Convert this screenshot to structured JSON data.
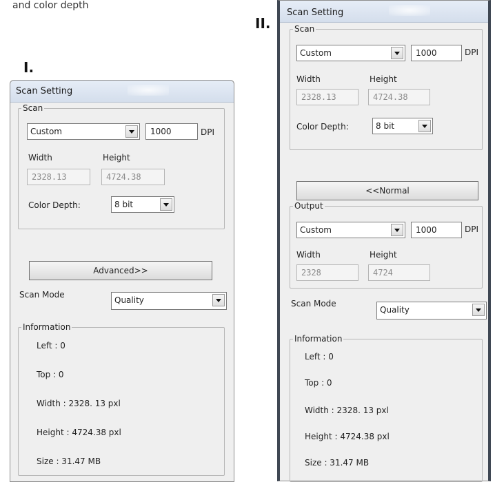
{
  "caption": "and color depth",
  "label_I": "I.",
  "label_II": "II.",
  "dialog1": {
    "title": "Scan Setting",
    "scan_legend": "Scan",
    "preset_value": "Custom",
    "dpi_value": "1000",
    "dpi_unit": "DPI",
    "width_label": "Width",
    "height_label": "Height",
    "width_value": "2328.13",
    "height_value": "4724.38",
    "color_depth_label": "Color Depth:",
    "color_depth_value": "8 bit",
    "advanced_button": "Advanced>>",
    "scan_mode_label": "Scan Mode",
    "scan_mode_value": "Quality",
    "info_legend": "Information",
    "info_left": "Left : 0",
    "info_top": "Top : 0",
    "info_width": "Width : 2328. 13 pxl",
    "info_height": "Height : 4724.38 pxl",
    "info_size": "Size : 31.47 MB"
  },
  "dialog2": {
    "title": "Scan Setting",
    "scan_legend": "Scan",
    "preset_value": "Custom",
    "dpi_value": "1000",
    "dpi_unit": "DPI",
    "width_label": "Width",
    "height_label": "Height",
    "width_value": "2328.13",
    "height_value": "4724.38",
    "color_depth_label": "Color Depth:",
    "color_depth_value": "8 bit",
    "normal_button": "<<Normal",
    "output_legend": "Output",
    "out_preset_value": "Custom",
    "out_dpi_value": "1000",
    "out_dpi_unit": "DPI",
    "out_width_label": "Width",
    "out_height_label": "Height",
    "out_width_value": "2328",
    "out_height_value": "4724",
    "scan_mode_label": "Scan Mode",
    "scan_mode_value": "Quality",
    "info_legend": "Information",
    "info_left": "Left : 0",
    "info_top": "Top : 0",
    "info_width": "Width : 2328. 13 pxl",
    "info_height": "Height : 4724.38 pxl",
    "info_size": "Size : 31.47 MB"
  }
}
